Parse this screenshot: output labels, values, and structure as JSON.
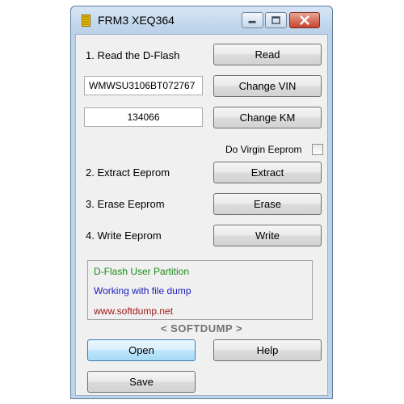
{
  "window": {
    "title": "FRM3 XEQ364",
    "icon": "chip-icon"
  },
  "steps": {
    "read_label": "1. Read the D-Flash",
    "read_button": "Read",
    "vin_value": "WMWSU3106BT072767",
    "change_vin_button": "Change VIN",
    "km_value": "134066",
    "change_km_button": "Change KM",
    "virgin_label": "Do Virgin Eeprom",
    "virgin_checked": false,
    "extract_label": "2. Extract Eeprom",
    "extract_button": "Extract",
    "erase_label": "3. Erase Eeprom",
    "erase_button": "Erase",
    "write_label": "4. Write Eeprom",
    "write_button": "Write"
  },
  "info": {
    "line1": "D-Flash User Partition",
    "line2": "Working with file dump",
    "line3": "www.softdump.net"
  },
  "brand": "< SOFTDUMP >",
  "bottom": {
    "open_button": "Open",
    "help_button": "Help",
    "save_button": "Save"
  },
  "colors": {
    "info_line1": "#1c8a1c",
    "info_line2": "#1c1cc0",
    "info_line3": "#a01818",
    "brand": "#707070"
  }
}
